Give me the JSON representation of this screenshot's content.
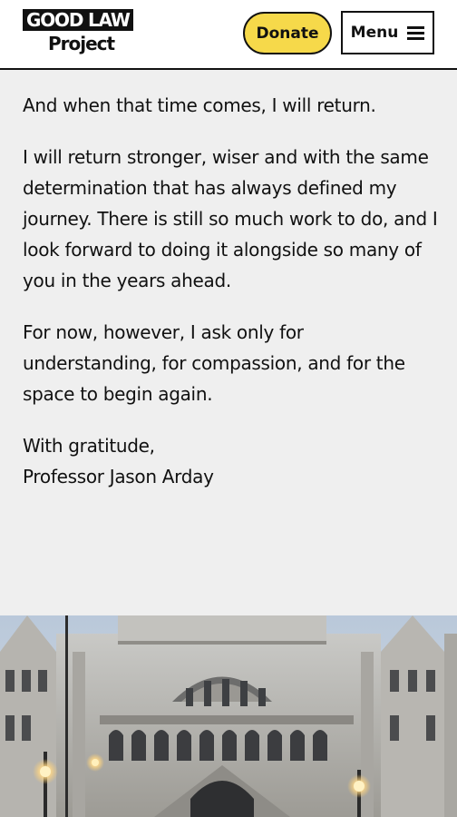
{
  "header": {
    "logo": {
      "line1": "GOOD LAW",
      "line2": "Project"
    },
    "donate_label": "Donate",
    "menu_label": "Menu",
    "icons": {
      "menu": "hamburger-menu-icon"
    },
    "colors": {
      "donate_bg": "#f6d94a",
      "border": "#111111"
    }
  },
  "article": {
    "paragraphs": [
      "And when that time comes, I will return.",
      "I will return stronger, wiser and with the same determination that has always defined my journey. There is still so much work to do, and I look forward to doing it alongside so many of you in the years ahead.",
      "For now, however, I ask only for understanding, for compassion, and for the space to begin again."
    ],
    "signoff": {
      "closing": "With gratitude,",
      "name": "Professor Jason Arday"
    }
  },
  "hero_image": {
    "subject": "Royal Courts of Justice facade"
  }
}
